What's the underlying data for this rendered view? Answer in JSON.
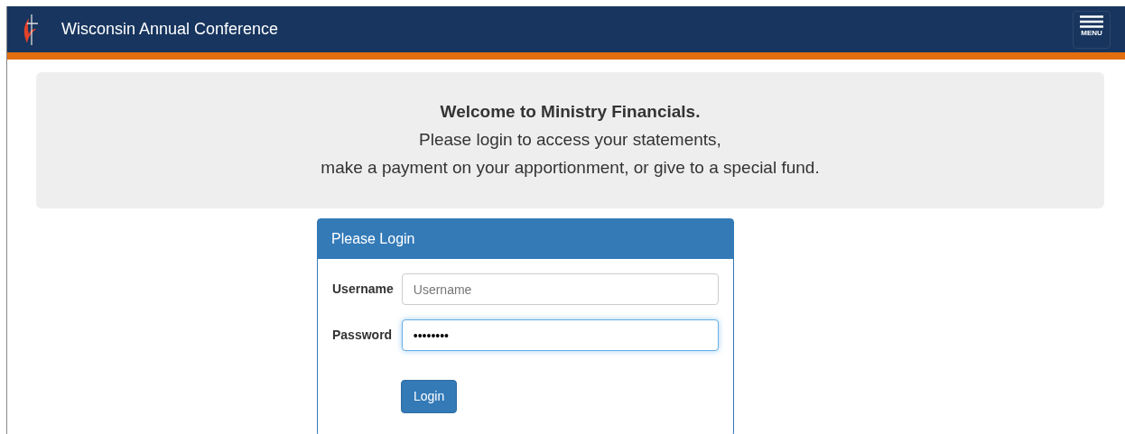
{
  "navbar": {
    "title": "Wisconsin Annual Conference",
    "menu_label": "MENU"
  },
  "welcome": {
    "heading": "Welcome to Ministry Financials.",
    "lines": [
      "Please login to access your statements,",
      "make a payment on your apportionment, or give to a special fund."
    ]
  },
  "login": {
    "title": "Please Login",
    "fields": [
      {
        "label": "Username",
        "placeholder": "Username",
        "focused": false
      },
      {
        "label": "Password",
        "value": "••••••••",
        "focused": true
      }
    ],
    "button": "Login"
  }
}
